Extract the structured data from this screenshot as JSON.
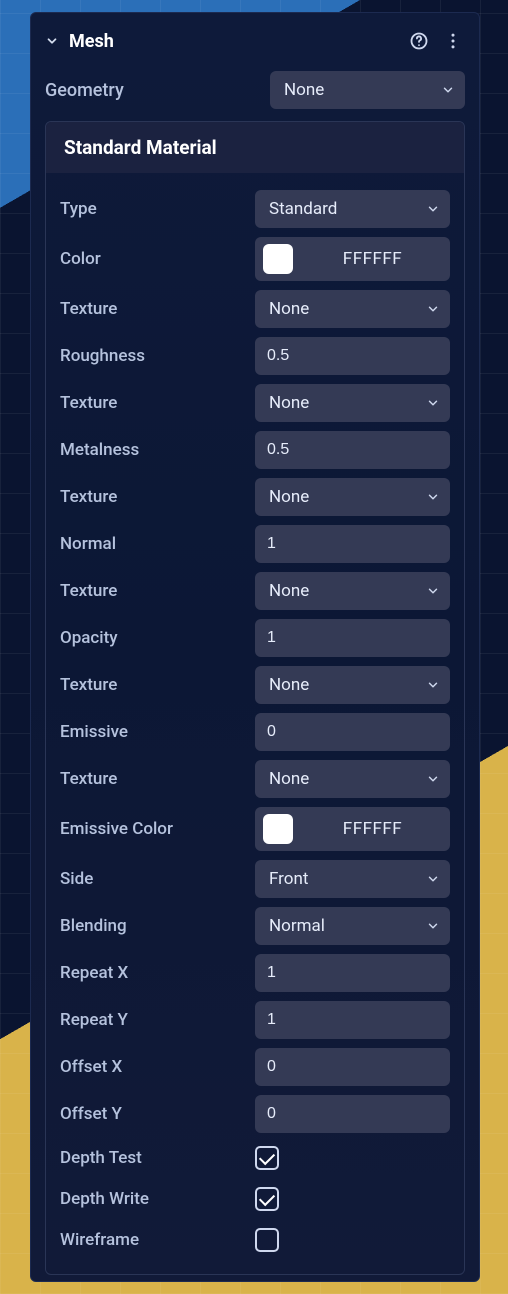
{
  "section": {
    "title": "Mesh"
  },
  "geometry": {
    "label": "Geometry",
    "value": "None"
  },
  "material": {
    "header": "Standard Material",
    "type": {
      "label": "Type",
      "value": "Standard"
    },
    "color": {
      "label": "Color",
      "hex": "FFFFFF",
      "swatch": "#FFFFFF"
    },
    "texture1": {
      "label": "Texture",
      "value": "None"
    },
    "roughness": {
      "label": "Roughness",
      "value": "0.5"
    },
    "texture2": {
      "label": "Texture",
      "value": "None"
    },
    "metalness": {
      "label": "Metalness",
      "value": "0.5"
    },
    "texture3": {
      "label": "Texture",
      "value": "None"
    },
    "normal": {
      "label": "Normal",
      "value": "1"
    },
    "texture4": {
      "label": "Texture",
      "value": "None"
    },
    "opacity": {
      "label": "Opacity",
      "value": "1"
    },
    "texture5": {
      "label": "Texture",
      "value": "None"
    },
    "emissive": {
      "label": "Emissive",
      "value": "0"
    },
    "texture6": {
      "label": "Texture",
      "value": "None"
    },
    "emissiveColor": {
      "label": "Emissive Color",
      "hex": "FFFFFF",
      "swatch": "#FFFFFF"
    },
    "side": {
      "label": "Side",
      "value": "Front"
    },
    "blending": {
      "label": "Blending",
      "value": "Normal"
    },
    "repeatX": {
      "label": "Repeat X",
      "value": "1"
    },
    "repeatY": {
      "label": "Repeat Y",
      "value": "1"
    },
    "offsetX": {
      "label": "Offset X",
      "value": "0"
    },
    "offsetY": {
      "label": "Offset Y",
      "value": "0"
    },
    "depthTest": {
      "label": "Depth Test",
      "checked": true
    },
    "depthWrite": {
      "label": "Depth Write",
      "checked": true
    },
    "wireframe": {
      "label": "Wireframe",
      "checked": false
    }
  }
}
